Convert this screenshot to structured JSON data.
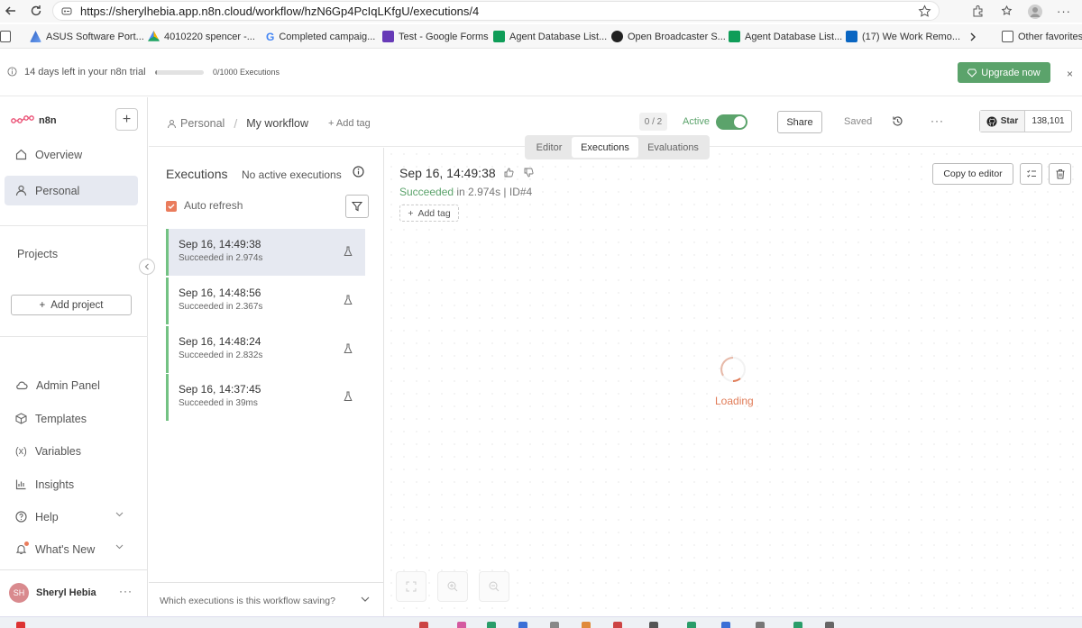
{
  "browser": {
    "url": "https://sherylhebia.app.n8n.cloud/workflow/hzN6Gp4PcIqLKfgU/executions/4",
    "bookmarks": [
      {
        "label": "ASUS Software Port..."
      },
      {
        "label": "4010220 spencer -..."
      },
      {
        "label": "Completed campaig..."
      },
      {
        "label": "Test - Google Forms"
      },
      {
        "label": "Agent Database List..."
      },
      {
        "label": "Open Broadcaster S..."
      },
      {
        "label": "Agent Database List..."
      },
      {
        "label": "(17) We Work Remo..."
      }
    ],
    "other_favorites": "Other favorites"
  },
  "banner": {
    "trial_text": "14 days left in your n8n trial",
    "executions_used": 0.005,
    "executions_count": "0/1000 Executions",
    "upgrade_label": "Upgrade now",
    "close": "×"
  },
  "sidebar": {
    "logo_text": "n8n",
    "new_button": "+",
    "items": [
      {
        "label": "Overview"
      },
      {
        "label": "Personal"
      }
    ],
    "projects_label": "Projects",
    "add_project_label": "Add project",
    "bottom_items": [
      {
        "label": "Admin Panel"
      },
      {
        "label": "Templates"
      },
      {
        "label": "Variables"
      },
      {
        "label": "Insights"
      },
      {
        "label": "Help"
      },
      {
        "label": "What's New"
      }
    ],
    "user": {
      "initials": "SH",
      "name": "Sheryl Hebia",
      "menu": "···"
    }
  },
  "header": {
    "breadcrumb_root": "Personal",
    "separator": "/",
    "workflow_name": "My workflow",
    "add_tag": "+ Add tag",
    "version": "0 / 2",
    "active_label": "Active",
    "share_label": "Share",
    "saved_label": "Saved",
    "more": "···",
    "github_star": "Star",
    "github_count": "138,101"
  },
  "tabs": [
    {
      "label": "Editor"
    },
    {
      "label": "Executions"
    },
    {
      "label": "Evaluations"
    }
  ],
  "executions": {
    "title": "Executions",
    "no_active": "No active executions",
    "auto_refresh": "Auto refresh",
    "items": [
      {
        "time": "Sep 16, 14:49:38",
        "status": "Succeeded in 2.974s"
      },
      {
        "time": "Sep 16, 14:48:56",
        "status": "Succeeded in 2.367s"
      },
      {
        "time": "Sep 16, 14:48:24",
        "status": "Succeeded in 2.832s"
      },
      {
        "time": "Sep 16, 14:37:45",
        "status": "Succeeded in 39ms"
      }
    ],
    "footer_question": "Which executions is this workflow saving?"
  },
  "detail": {
    "date": "Sep 16, 14:49:38",
    "status": "Succeeded",
    "duration": " in 2.974s | ID#4",
    "add_tag": "Add tag",
    "copy_to_editor": "Copy to editor",
    "loading": "Loading"
  },
  "colors": {
    "accent": "#ea7c5c",
    "success": "#5ba36b",
    "selected_bg": "#e6e9f1"
  }
}
